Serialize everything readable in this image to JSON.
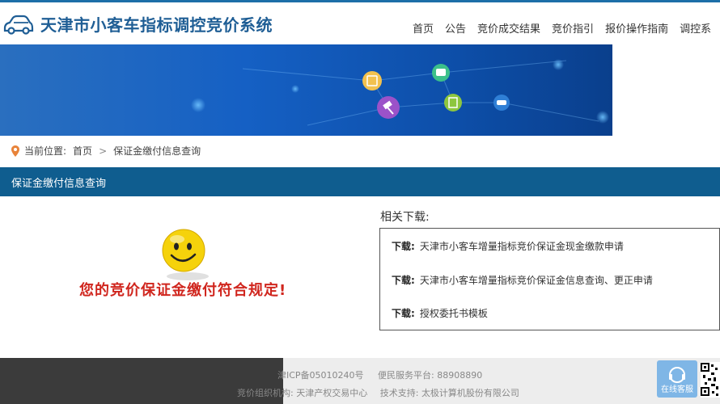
{
  "header": {
    "site_title": "天津市小客车指标调控竞价系统",
    "nav": [
      "首页",
      "公告",
      "竞价成交结果",
      "竞价指引",
      "报价操作指南",
      "调控系"
    ]
  },
  "breadcrumb": {
    "label": "当前位置:",
    "home": "首页",
    "separator": ">",
    "current": "保证金缴付信息查询"
  },
  "section": {
    "title": "保证金缴付信息查询"
  },
  "result": {
    "message": "您的竞价保证金缴付符合规定!"
  },
  "downloads": {
    "heading": "相关下载:",
    "prefix": "下载:",
    "items": [
      "天津市小客车增量指标竞价保证金现金缴款申请",
      "天津市小客车增量指标竞价保证金信息查询、更正申请",
      "授权委托书模板"
    ]
  },
  "footer": {
    "icp": "津ICP备05010240号",
    "hotline_label": "便民服务平台:",
    "hotline": "88908890",
    "org_label": "竞价组织机构:",
    "org": "天津产权交易中心",
    "support_label": "技术支持:",
    "support": "太极计算机股份有限公司",
    "service_button": "在线客服"
  },
  "colors": {
    "accent": "#0f5d8f",
    "title": "#1f5e95",
    "result": "#d0261e"
  }
}
